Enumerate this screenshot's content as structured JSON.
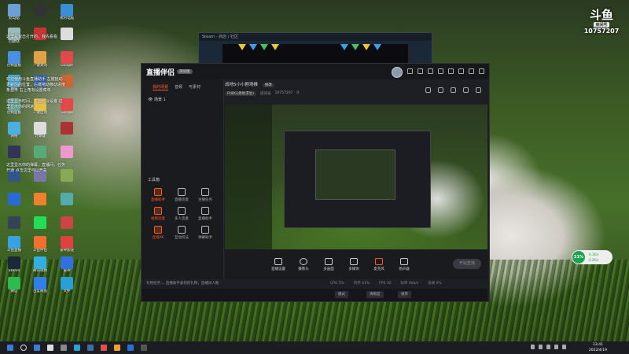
{
  "desktop": {
    "icons": [
      {
        "label": "此电脑",
        "color": "#6d9fd6"
      },
      {
        "label": "",
        "color": "#333"
      },
      {
        "label": "我的电脑",
        "color": "#3a8ed6"
      },
      {
        "label": "回收站",
        "color": "#9bb"
      },
      {
        "label": "",
        "color": "#c33"
      },
      {
        "label": "",
        "color": "#ddd"
      },
      {
        "label": "控制面板",
        "color": "#4a90e2"
      },
      {
        "label": "一键关闭",
        "color": "#e2a04a"
      },
      {
        "label": "Google",
        "color": "#e24a4a"
      },
      {
        "label": "网络",
        "color": "#4ab0e2"
      },
      {
        "label": "",
        "color": "#36a"
      },
      {
        "label": "",
        "color": "#c63"
      },
      {
        "label": "控制面板",
        "color": "#6a9"
      },
      {
        "label": "一键启动",
        "color": "#e2c04a"
      },
      {
        "label": "Google",
        "color": "#e24a4a"
      },
      {
        "label": "网络",
        "color": "#4ab0e2"
      },
      {
        "label": "计算器",
        "color": "#ddd"
      },
      {
        "label": "",
        "color": "#a33"
      },
      {
        "label": "",
        "color": "#335"
      },
      {
        "label": "",
        "color": "#5a7"
      },
      {
        "label": "",
        "color": "#e9c"
      },
      {
        "label": "",
        "color": "#358"
      },
      {
        "label": "",
        "color": "#77a"
      },
      {
        "label": "",
        "color": "#8a5"
      },
      {
        "label": "",
        "color": "#2a6ad6"
      },
      {
        "label": "",
        "color": "#f08030"
      },
      {
        "label": "",
        "color": "#5aa"
      },
      {
        "label": "",
        "color": "#345"
      },
      {
        "label": "",
        "color": "#2d5"
      },
      {
        "label": "",
        "color": "#c44"
      },
      {
        "label": "斗鱼直播",
        "color": "#3aa0e0"
      },
      {
        "label": "斗鱼伴侣",
        "color": "#f07030"
      },
      {
        "label": "雷神加速",
        "color": "#e04040"
      },
      {
        "label": "Steam",
        "color": "#1b2838"
      },
      {
        "label": "腾讯视频",
        "color": "#30b0e0"
      },
      {
        "label": "雷神",
        "color": "#3070e0"
      },
      {
        "label": "微信",
        "color": "#2dbb4e"
      },
      {
        "label": "百度网盘",
        "color": "#2f80ed"
      },
      {
        "label": "文件",
        "color": "#2a9fd6"
      }
    ],
    "notes": [
      "这里是双击打开的，我先看看",
      "欢迎使用斗鱼直播助手 左键拖动更新你的位置，右键拖动移动进度条显示 右上角有设置菜单",
      "这里显示时间，下面可以设置 这里显示你的网速",
      "这里显示你的弹幕，直播间，任务开通 点击这里可以开关"
    ],
    "douyu_logo": {
      "mark": "斗鱼",
      "room_label": "房间号",
      "room_number": "10757207"
    }
  },
  "steam": {
    "title": "Steam - 商店 / 社区"
  },
  "app": {
    "logo": "直播伴侣",
    "badge": "测试版",
    "left_tabs": [
      "我的场景",
      "音频",
      "可素材"
    ],
    "scene": "场景 1",
    "tools_title": "工具箱",
    "tools": [
      {
        "label": "直播助手",
        "active": true
      },
      {
        "label": "直播连麦",
        "active": false
      },
      {
        "label": "主播任务",
        "active": false
      },
      {
        "label": "视频连麦",
        "active": true
      },
      {
        "label": "多人连麦",
        "active": false
      },
      {
        "label": "直播助手",
        "active": false
      },
      {
        "label": "连线PK",
        "active": true
      },
      {
        "label": "互动玩法",
        "active": false
      },
      {
        "label": "弹幕助手",
        "active": false
      }
    ],
    "room_title": "战地5小小剧场推",
    "room_tag": "修改",
    "category": "PUBG(绝地求生)",
    "room_id_label": "房间号",
    "room_id": "10757207",
    "viewers": "0",
    "bottom_buttons": [
      "直播设置",
      "摄像头",
      "多画面",
      "多媒体",
      "麦克风",
      "扬声器"
    ],
    "start_button": "开始直播",
    "status_text": "礼物任务：，直播助手收到的礼物，直播间人数",
    "stats": [
      "CPU 5%",
      "内存 41%",
      "FPS 30",
      "码率 0kb/s",
      "丢帧 0%"
    ],
    "footer_options": [
      "模式",
      "清晰度",
      "帧率"
    ]
  },
  "perf": {
    "percent": "21%",
    "up": "0.1K/s",
    "down": "0.2K/s"
  },
  "taskbar": {
    "icons": [
      "#3a7bd5",
      "#ddd",
      "#888",
      "#2aa0d6",
      "#3a6ea5",
      "#e05050",
      "#f0a030",
      "#2a6fd6",
      "#555"
    ],
    "time": "13:41",
    "date": "2022/4/19"
  }
}
